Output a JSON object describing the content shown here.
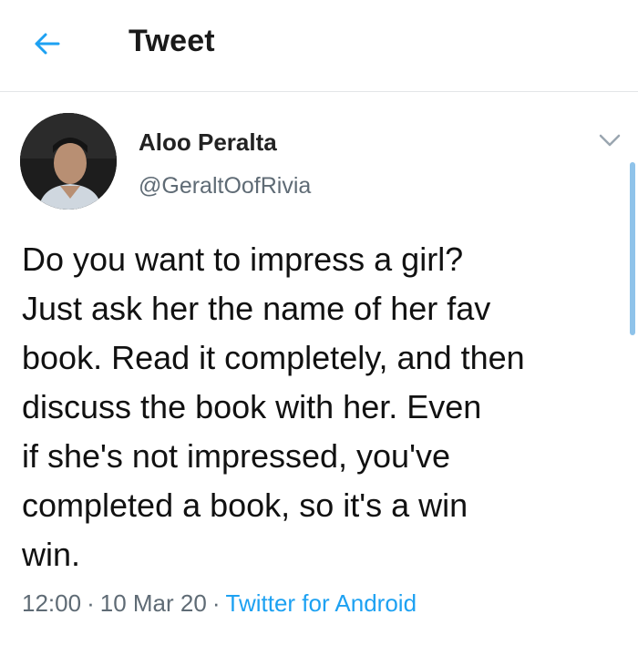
{
  "header": {
    "title": "Tweet",
    "back_icon": "arrow-left-icon",
    "accent": "#1da1f2"
  },
  "author": {
    "name": "Aloo Peralta",
    "handle": "@GeraltOofRivia"
  },
  "tweet": {
    "text": "Do you want to impress a girl?\nJust ask her the name of her fav\nbook. Read it completely, and then\ndiscuss the book with her. Even\nif she's not impressed, you've\ncompleted a book, so it's a win\nwin.",
    "time": "12:00",
    "date": "10 Mar 20",
    "separator": "·",
    "source": "Twitter for Android"
  },
  "colors": {
    "link": "#1da1f2",
    "muted": "#5f6b75",
    "divider": "#e3e6e8"
  }
}
